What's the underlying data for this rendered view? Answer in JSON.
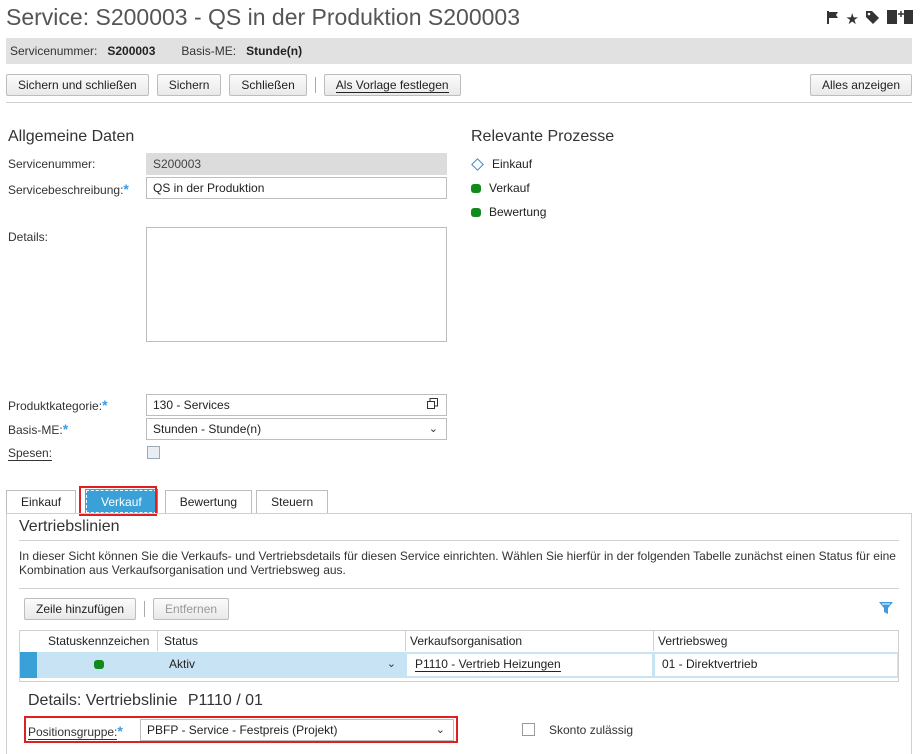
{
  "header": {
    "title": "Service: S200003 - QS in der Produktion S200003",
    "icons": [
      "flag-icon",
      "star-icon",
      "tag-icon",
      "add-page-icon"
    ]
  },
  "infobar": {
    "servicenummer_label": "Servicenummer:",
    "servicenummer_value": "S200003",
    "basis_me_label": "Basis-ME:",
    "basis_me_value": "Stunde(n)"
  },
  "toolbar": {
    "save_close": "Sichern und schließen",
    "save": "Sichern",
    "close": "Schließen",
    "template": "Als Vorlage festlegen",
    "show_all": "Alles anzeigen"
  },
  "general": {
    "title": "Allgemeine Daten",
    "servicenummer_label": "Servicenummer:",
    "servicenummer_value": "S200003",
    "beschreibung_label": "Servicebeschreibung:",
    "beschreibung_value": "QS in der Produktion",
    "details_label": "Details:",
    "details_value": "",
    "produktkategorie_label": "Produktkategorie:",
    "produktkategorie_value": "130 - Services",
    "basis_me_label": "Basis-ME:",
    "basis_me_value": "Stunden - Stunde(n)",
    "spesen_label": "Spesen:"
  },
  "processes": {
    "title": "Relevante Prozesse",
    "items": [
      "Einkauf",
      "Verkauf",
      "Bewertung"
    ]
  },
  "tabs": [
    "Einkauf",
    "Verkauf",
    "Bewertung",
    "Steuern"
  ],
  "sales": {
    "title": "Vertriebslinien",
    "info": "In dieser Sicht können Sie die Verkaufs- und Vertriebsdetails für diesen Service einrichten. Wählen Sie hierfür in der folgenden Tabelle zunächst einen Status für eine Kombination aus Verkaufsorganisation und Vertriebsweg aus.",
    "add_row": "Zeile hinzufügen",
    "remove": "Entfernen",
    "columns": [
      "Statuskennzeichen",
      "Status",
      "Verkaufsorganisation",
      "Vertriebsweg"
    ],
    "row": {
      "status": "Aktiv",
      "org": "P1110 - Vertrieb Heizungen",
      "weg": "01 - Direktvertrieb"
    },
    "details_title": "Details: Vertriebslinie",
    "details_id": "P1110 / 01",
    "positionsgruppe_label": "Positionsgruppe:",
    "positionsgruppe_value": "PBFP - Service - Festpreis (Projekt)",
    "skonto_label": "Skonto zulässig"
  },
  "colors": {
    "accent": "#3aa0d8",
    "status_green": "#118a1d",
    "highlight": "#e02020",
    "row_select": "#c8e3f3"
  }
}
